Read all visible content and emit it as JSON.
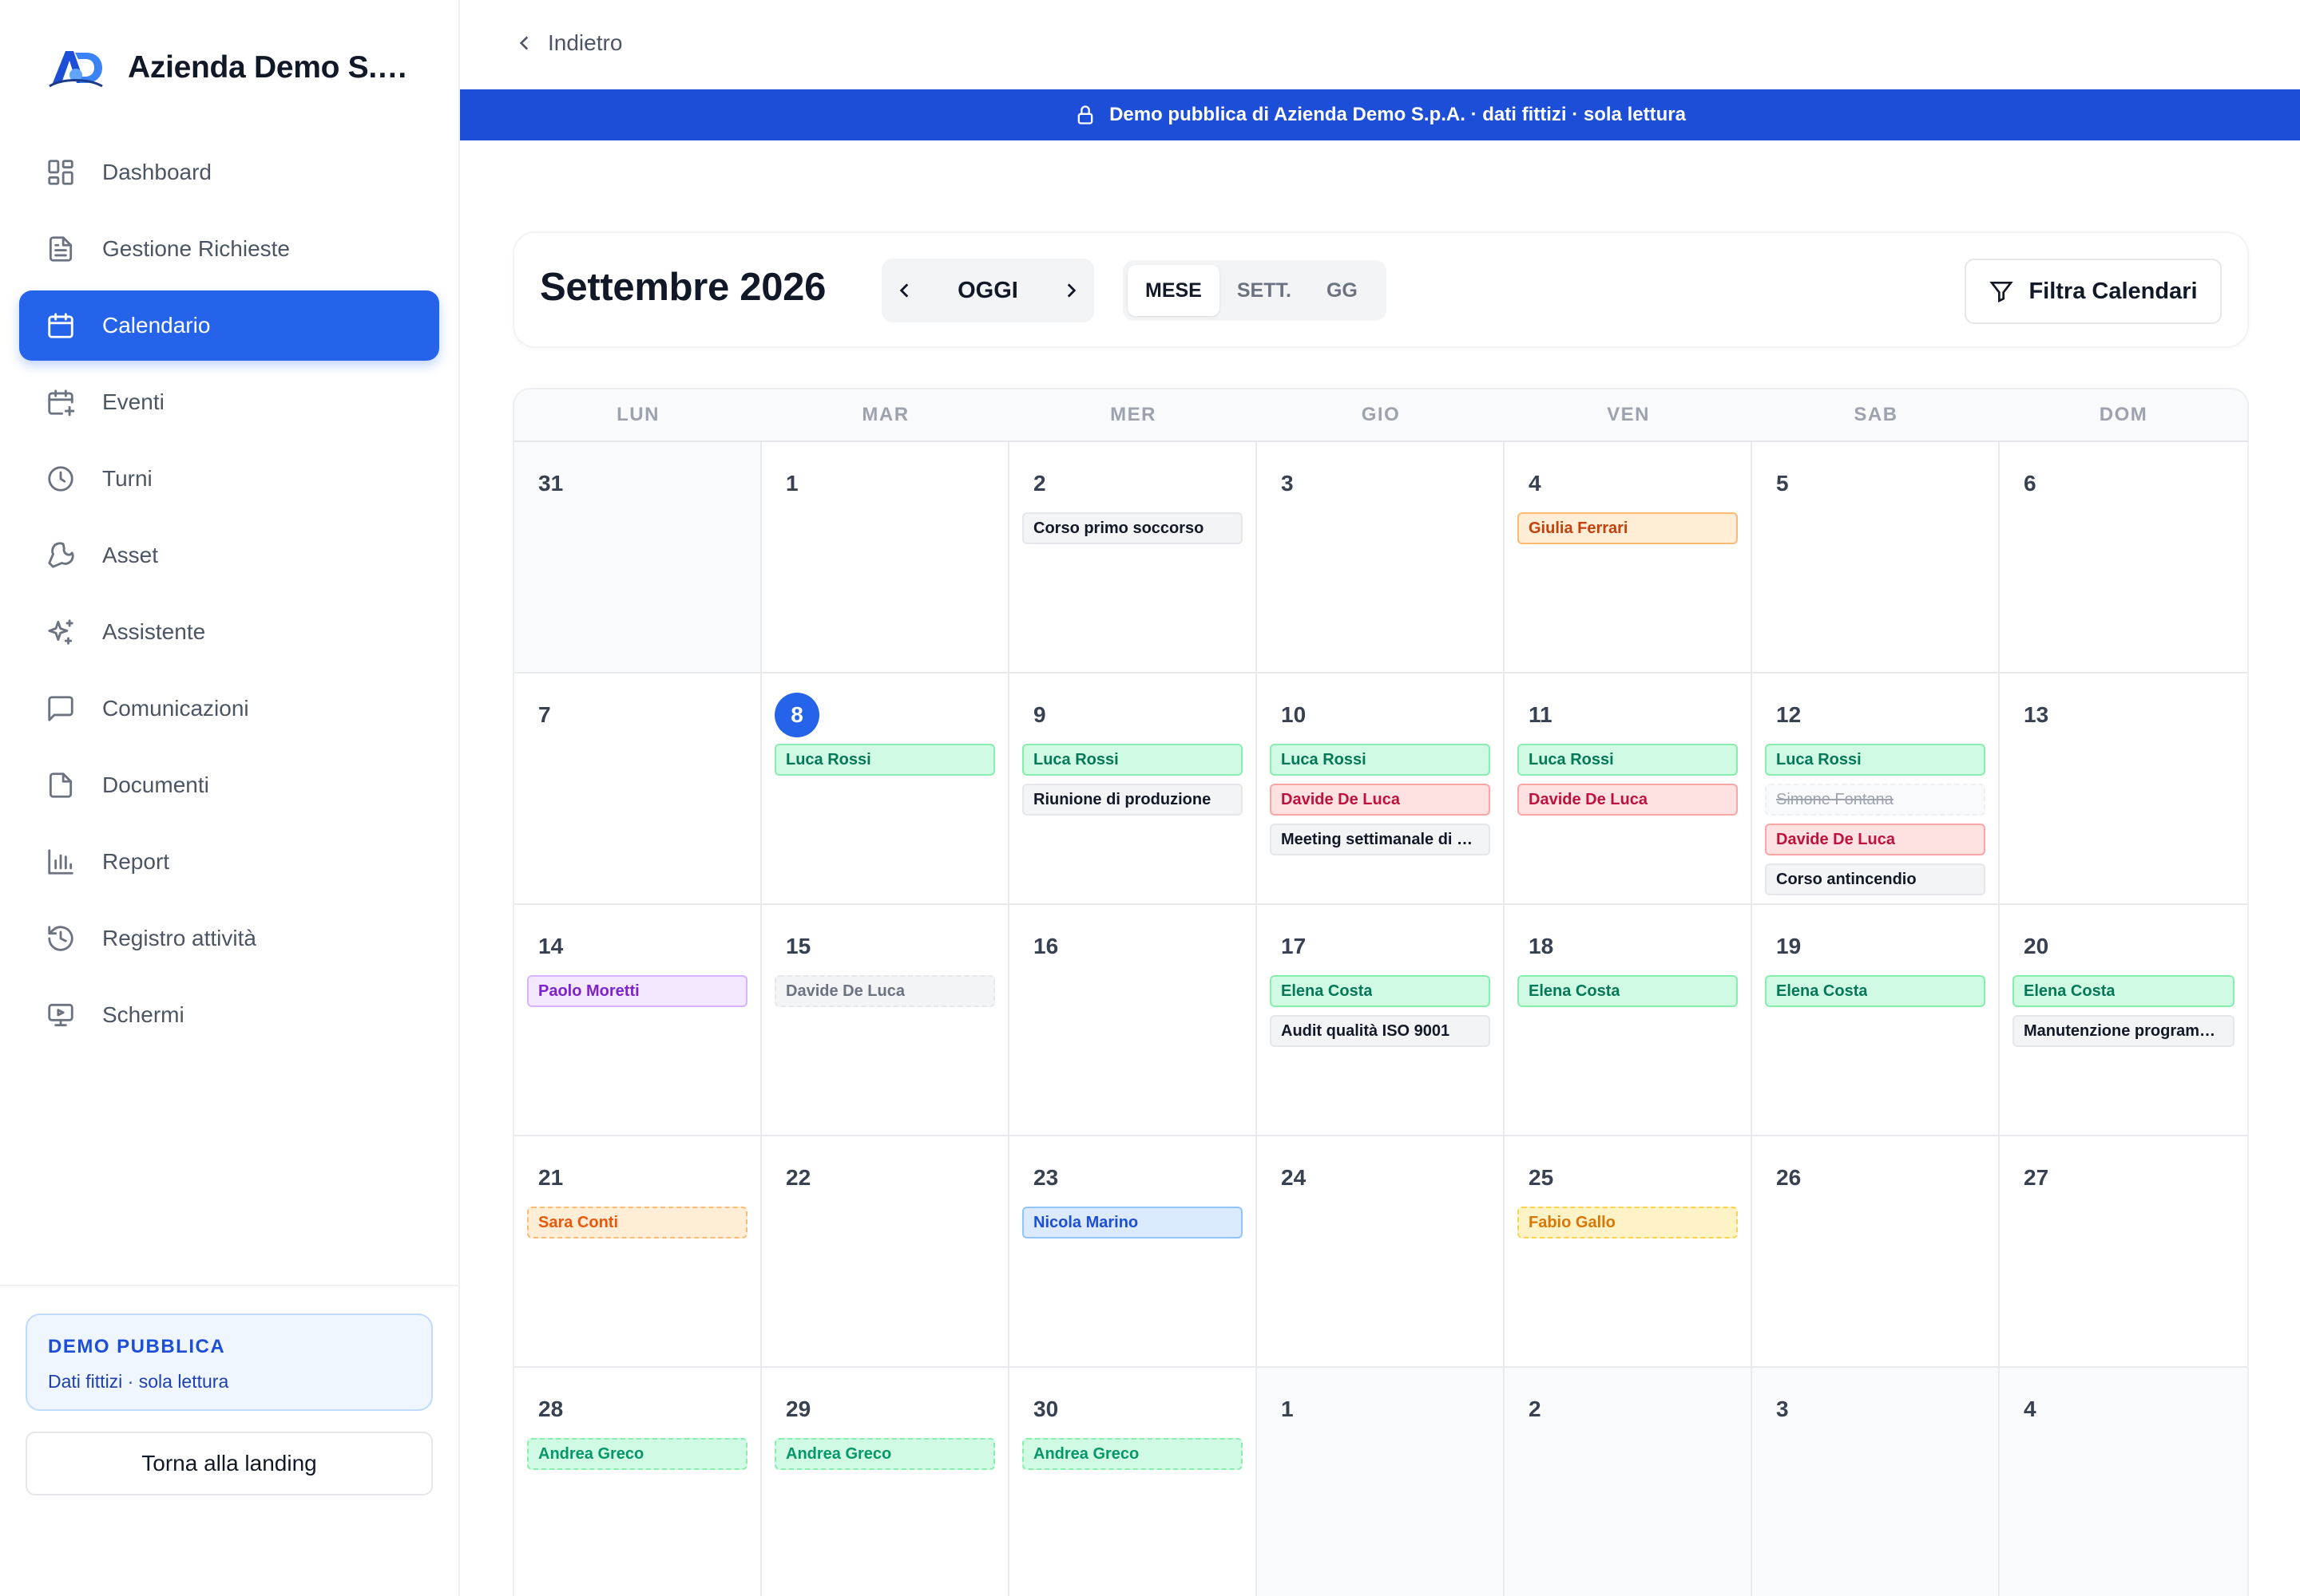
{
  "brand": {
    "name": "Azienda Demo S.…",
    "logo_text": "AD"
  },
  "sidebar": {
    "items": [
      {
        "label": "Dashboard",
        "icon": "dashboard-icon",
        "active": false
      },
      {
        "label": "Gestione Richieste",
        "icon": "document-icon",
        "active": false
      },
      {
        "label": "Calendario",
        "icon": "calendar-icon",
        "active": true
      },
      {
        "label": "Eventi",
        "icon": "calendar-plus-icon",
        "active": false
      },
      {
        "label": "Turni",
        "icon": "clock-icon",
        "active": false
      },
      {
        "label": "Asset",
        "icon": "wrench-icon",
        "active": false
      },
      {
        "label": "Assistente",
        "icon": "sparkles-icon",
        "active": false
      },
      {
        "label": "Comunicazioni",
        "icon": "chat-icon",
        "active": false
      },
      {
        "label": "Documenti",
        "icon": "file-icon",
        "active": false
      },
      {
        "label": "Report",
        "icon": "bar-chart-icon",
        "active": false
      },
      {
        "label": "Registro attività",
        "icon": "history-icon",
        "active": false
      },
      {
        "label": "Schermi",
        "icon": "monitor-icon",
        "active": false
      }
    ],
    "demo_title": "DEMO PUBBLICA",
    "demo_sub": "Dati fittizi · sola lettura",
    "landing_label": "Torna alla landing"
  },
  "header": {
    "back_label": "Indietro",
    "banner": "Demo pubblica di Azienda Demo S.p.A. · dati fittizi · sola lettura"
  },
  "toolbar": {
    "month_title": "Settembre 2026",
    "today_label": "OGGI",
    "views": [
      "MESE",
      "SETT.",
      "GG"
    ],
    "active_view": "MESE",
    "filter_label": "Filtra Calendari"
  },
  "calendar": {
    "weekdays": [
      "LUN",
      "MAR",
      "MER",
      "GIO",
      "VEN",
      "SAB",
      "DOM"
    ],
    "days": [
      {
        "n": "31",
        "other": true,
        "events": []
      },
      {
        "n": "1",
        "events": []
      },
      {
        "n": "2",
        "events": [
          {
            "t": "Corso primo soccorso",
            "c": "gray"
          }
        ]
      },
      {
        "n": "3",
        "events": []
      },
      {
        "n": "4",
        "events": [
          {
            "t": "Giulia Ferrari",
            "c": "orange"
          }
        ]
      },
      {
        "n": "5",
        "events": []
      },
      {
        "n": "6",
        "events": []
      },
      {
        "n": "7",
        "events": []
      },
      {
        "n": "8",
        "today": true,
        "events": [
          {
            "t": "Luca Rossi",
            "c": "green"
          }
        ]
      },
      {
        "n": "9",
        "events": [
          {
            "t": "Luca Rossi",
            "c": "green"
          },
          {
            "t": "Riunione di produzione",
            "c": "gray"
          }
        ]
      },
      {
        "n": "10",
        "events": [
          {
            "t": "Luca Rossi",
            "c": "green"
          },
          {
            "t": "Davide De Luca",
            "c": "red"
          },
          {
            "t": "Meeting settimanale di …",
            "c": "gray"
          }
        ]
      },
      {
        "n": "11",
        "events": [
          {
            "t": "Luca Rossi",
            "c": "green"
          },
          {
            "t": "Davide De Luca",
            "c": "red"
          }
        ]
      },
      {
        "n": "12",
        "events": [
          {
            "t": "Luca Rossi",
            "c": "green"
          },
          {
            "t": "Simone Fontana",
            "c": "strike"
          },
          {
            "t": "Davide De Luca",
            "c": "red"
          },
          {
            "t": "Corso antincendio",
            "c": "gray"
          }
        ]
      },
      {
        "n": "13",
        "events": []
      },
      {
        "n": "14",
        "events": [
          {
            "t": "Paolo Moretti",
            "c": "purple"
          }
        ]
      },
      {
        "n": "15",
        "events": [
          {
            "t": "Davide De Luca",
            "c": "gray-dash"
          }
        ]
      },
      {
        "n": "16",
        "events": []
      },
      {
        "n": "17",
        "events": [
          {
            "t": "Elena Costa",
            "c": "green"
          },
          {
            "t": "Audit qualità ISO 9001",
            "c": "gray"
          }
        ]
      },
      {
        "n": "18",
        "events": [
          {
            "t": "Elena Costa",
            "c": "green"
          }
        ]
      },
      {
        "n": "19",
        "events": [
          {
            "t": "Elena Costa",
            "c": "green"
          }
        ]
      },
      {
        "n": "20",
        "events": [
          {
            "t": "Elena Costa",
            "c": "green"
          },
          {
            "t": "Manutenzione program…",
            "c": "gray"
          }
        ]
      },
      {
        "n": "21",
        "events": [
          {
            "t": "Sara Conti",
            "c": "orange-dash"
          }
        ]
      },
      {
        "n": "22",
        "events": []
      },
      {
        "n": "23",
        "events": [
          {
            "t": "Nicola Marino",
            "c": "blue"
          }
        ]
      },
      {
        "n": "24",
        "events": []
      },
      {
        "n": "25",
        "events": [
          {
            "t": "Fabio Gallo",
            "c": "yellow-dash"
          }
        ]
      },
      {
        "n": "26",
        "events": []
      },
      {
        "n": "27",
        "events": []
      },
      {
        "n": "28",
        "events": [
          {
            "t": "Andrea Greco",
            "c": "green-dash"
          }
        ]
      },
      {
        "n": "29",
        "events": [
          {
            "t": "Andrea Greco",
            "c": "green-dash"
          }
        ]
      },
      {
        "n": "30",
        "events": [
          {
            "t": "Andrea Greco",
            "c": "green-dash"
          }
        ]
      },
      {
        "n": "1",
        "other": true,
        "events": []
      },
      {
        "n": "2",
        "other": true,
        "events": []
      },
      {
        "n": "3",
        "other": true,
        "events": []
      },
      {
        "n": "4",
        "other": true,
        "events": []
      }
    ]
  },
  "colors": {
    "accent": "#2563eb",
    "banner": "#1d4ed8"
  }
}
